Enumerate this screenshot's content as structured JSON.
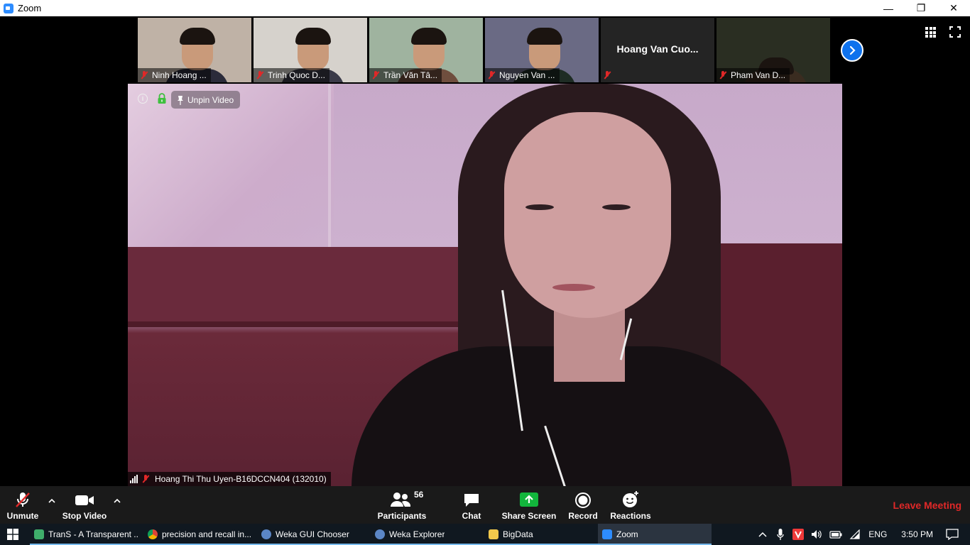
{
  "window": {
    "title": "Zoom",
    "minimize": "—",
    "maximize": "❐",
    "close": "✕"
  },
  "thumbnails": [
    {
      "name": "Ninh Hoang ...",
      "bg": "#bfb2a6",
      "shirt": "#2b2b3a"
    },
    {
      "name": "Trinh Quoc D...",
      "bg": "#d6d2cc",
      "shirt": "#3a3a48"
    },
    {
      "name": "Trần Văn Tâ...",
      "bg": "#9fb39f",
      "shirt": "#6f4e3e"
    },
    {
      "name": "Nguyen Van ...",
      "bg": "#6a6a84",
      "shirt": "#1e2c24"
    },
    {
      "name": "Hoang Van Cuo...",
      "video": false
    },
    {
      "name": "Pham Van D...",
      "bg": "#2a2e22",
      "shirt": "#3a2c20"
    }
  ],
  "main": {
    "unpin_label": "Unpin Video",
    "speaker_name": "Hoang Thi Thu Uyen-B16DCCN404 (132010)"
  },
  "toolbar": {
    "unmute": "Unmute",
    "stop_video": "Stop Video",
    "participants": "Participants",
    "participants_count": "56",
    "chat": "Chat",
    "share_screen": "Share Screen",
    "record": "Record",
    "reactions": "Reactions",
    "leave": "Leave Meeting"
  },
  "taskbar": {
    "tasks": [
      {
        "label": "TranS - A Transparent ...",
        "icon_color": "#3fae6b",
        "active": false
      },
      {
        "label": "precision and recall in...",
        "icon_color": "#e8a323",
        "active": false
      },
      {
        "label": "Weka GUI Chooser",
        "icon_color": "#5b86c6",
        "active": false
      },
      {
        "label": "Weka Explorer",
        "icon_color": "#5b86c6",
        "active": false
      },
      {
        "label": "BigData",
        "icon_color": "#f2c94c",
        "active": false
      },
      {
        "label": "Zoom",
        "icon_color": "#2d8cff",
        "active": true
      }
    ],
    "lang": "ENG",
    "time": "3:50 PM"
  },
  "colors": {
    "accent": "#0e72ed",
    "leave": "#e02828",
    "share": "#12b63c",
    "toolbar": "#1a1a1a"
  }
}
